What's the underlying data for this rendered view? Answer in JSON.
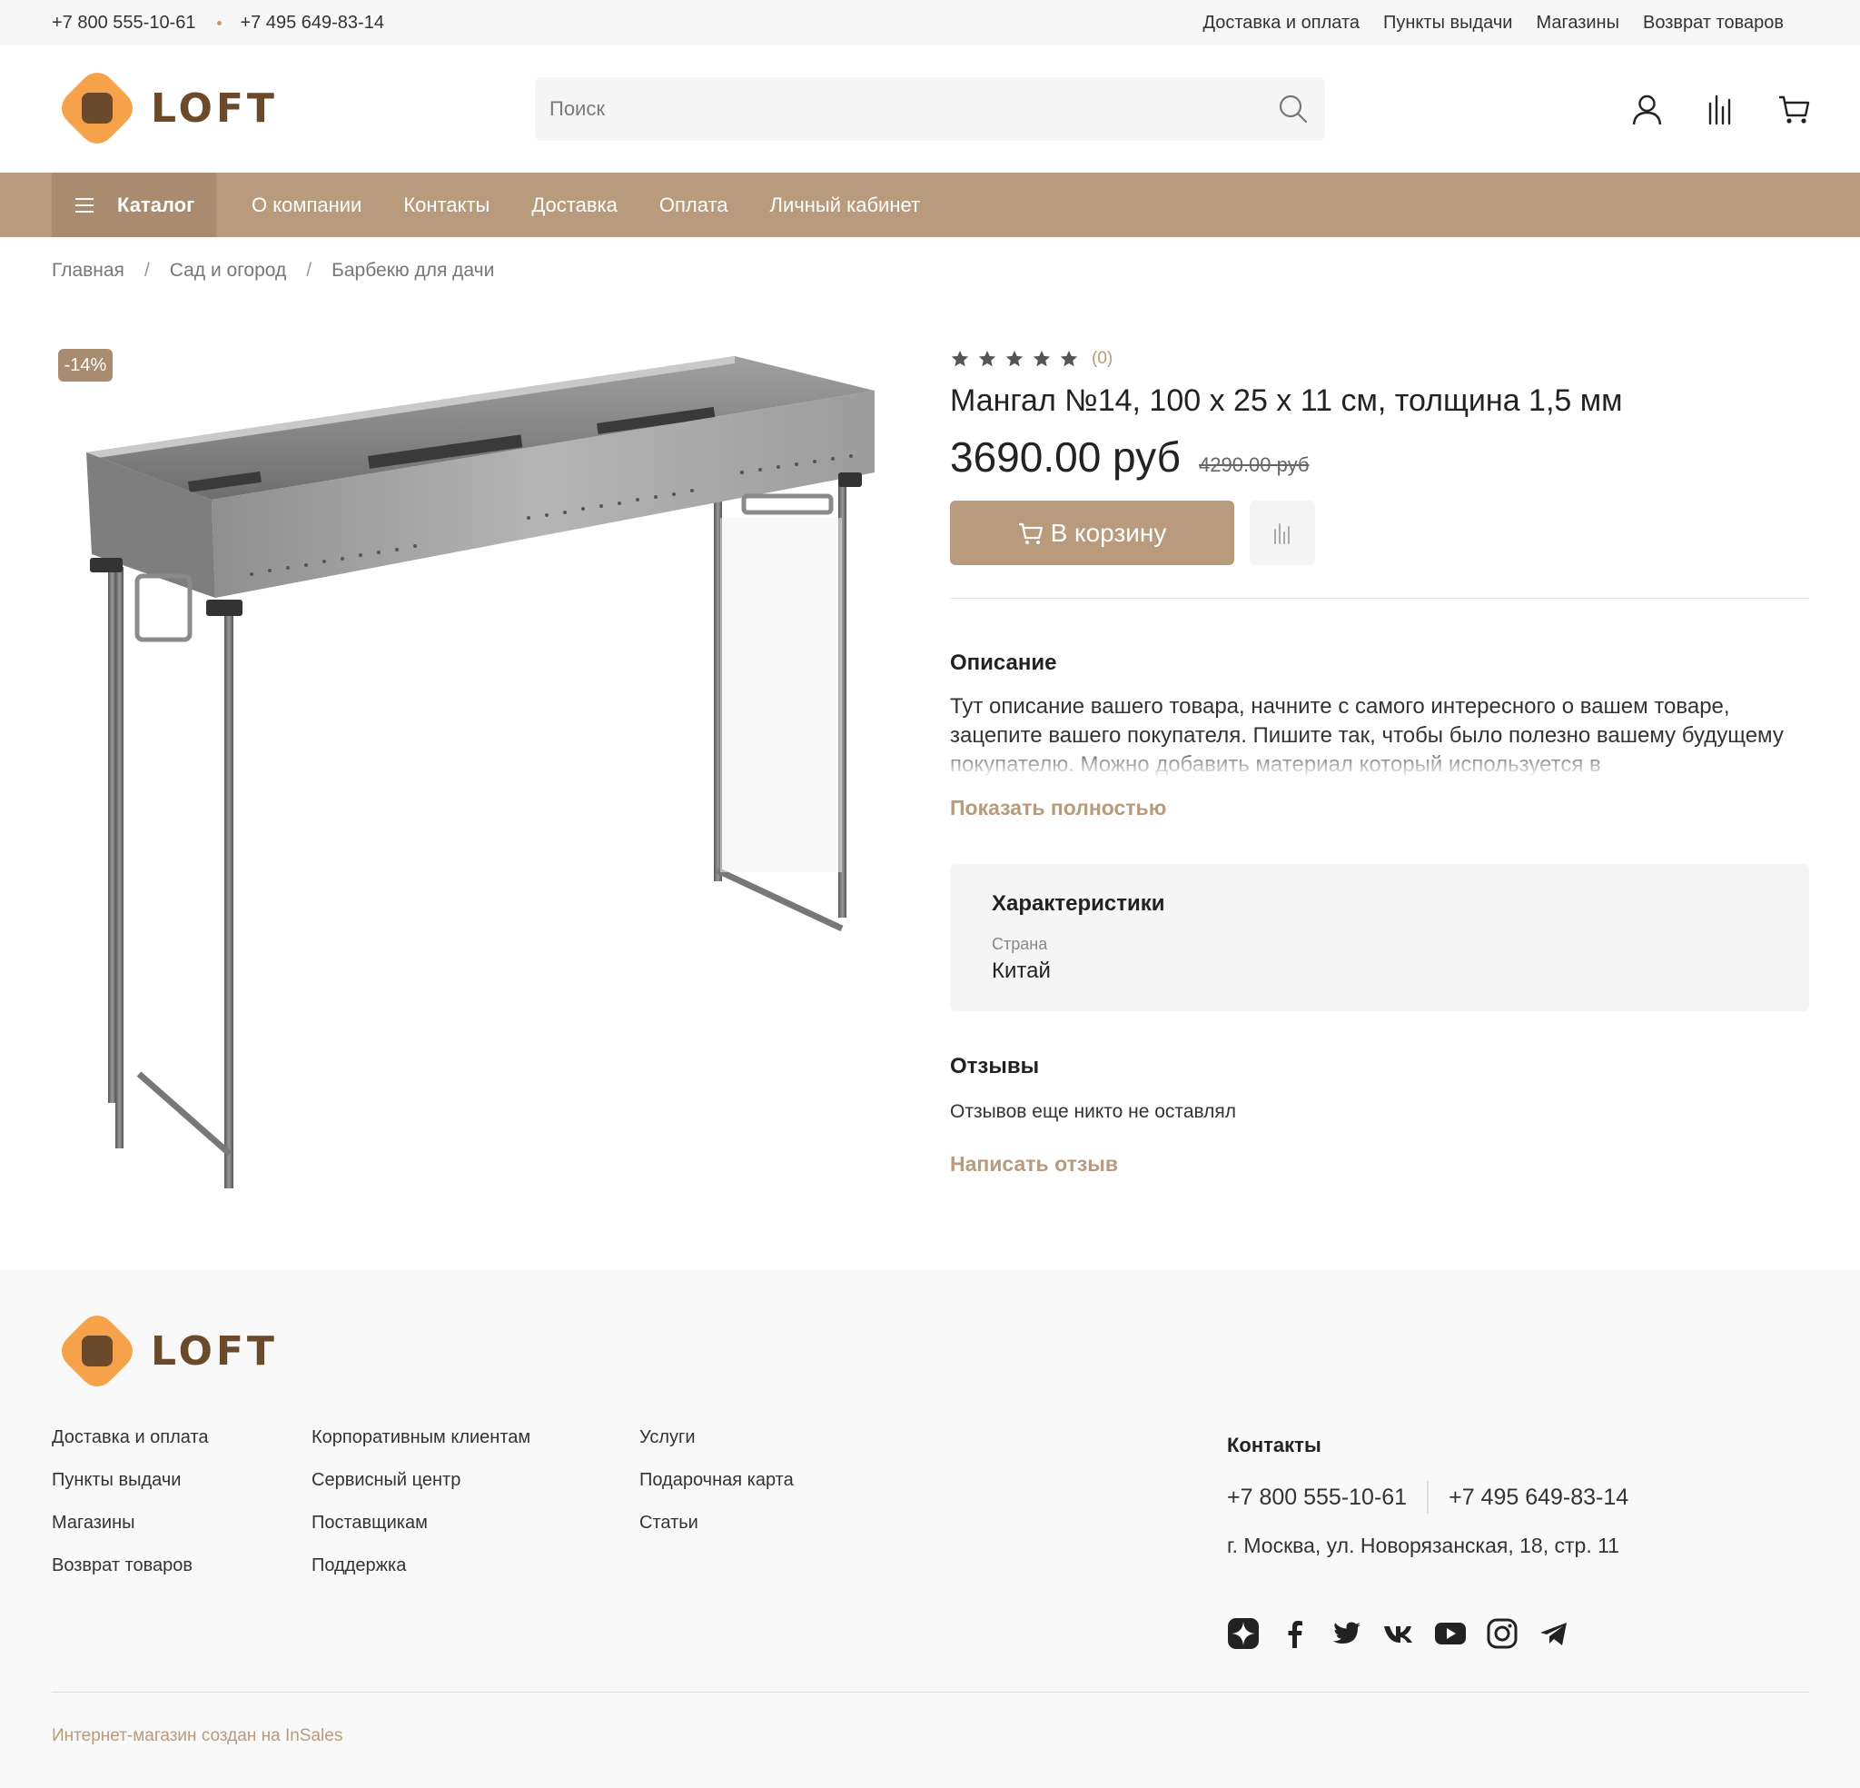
{
  "topbar": {
    "phone1": "+7 800 555-10-61",
    "phone2": "+7 495 649-83-14",
    "links": [
      "Доставка и оплата",
      "Пункты выдачи",
      "Магазины",
      "Возврат товаров"
    ]
  },
  "brand": {
    "name": "LOFT",
    "accent": "#b89a7c",
    "logo_orange": "#f5a24b",
    "logo_brown": "#6b4a2b"
  },
  "header": {
    "search_placeholder": "Поиск",
    "icons": [
      "user-icon",
      "compare-icon",
      "cart-icon"
    ]
  },
  "nav": {
    "catalog": "Каталог",
    "items": [
      "О компании",
      "Контакты",
      "Доставка",
      "Оплата",
      "Личный кабинет"
    ]
  },
  "breadcrumb": [
    "Главная",
    "Сад и огород",
    "Барбекю для дачи"
  ],
  "product": {
    "badge": "-14%",
    "rating": 0,
    "reviews_count": "(0)",
    "title": "Мангал №14, 100 х 25 х 11 см, толщина 1,5 мм",
    "price": "3690.00 руб",
    "old_price": "4290.00 руб",
    "add_to_cart": "В корзину",
    "description_title": "Описание",
    "description": "Тут описание вашего товара, начните с самого интересного о вашем товаре, зацепите вашего покупателя. Пишите так, чтобы было полезно вашему будущему покупателю. Можно добавить материал который используется в",
    "show_more": "Показать полностью",
    "characteristics_title": "Характеристики",
    "characteristics": [
      {
        "label": "Страна",
        "value": "Китай"
      }
    ],
    "reviews_title": "Отзывы",
    "reviews_empty": "Отзывов еще никто не оставлял",
    "write_review": "Написать отзыв"
  },
  "footer": {
    "col1": [
      "Доставка и оплата",
      "Пункты выдачи",
      "Магазины",
      "Возврат товаров"
    ],
    "col2": [
      "Корпоративным клиентам",
      "Сервисный центр",
      "Поставщикам",
      "Поддержка"
    ],
    "col3": [
      "Услуги",
      "Подарочная карта",
      "Статьи"
    ],
    "contacts_title": "Контакты",
    "phone1": "+7 800 555-10-61",
    "phone2": "+7 495 649-83-14",
    "address": "г. Москва, ул. Новорязанская, 18, стр. 11",
    "social": [
      "yandex-zen-icon",
      "facebook-icon",
      "twitter-icon",
      "vk-icon",
      "youtube-icon",
      "instagram-icon",
      "telegram-icon"
    ],
    "credit": "Интернет-магазин создан на InSales"
  }
}
